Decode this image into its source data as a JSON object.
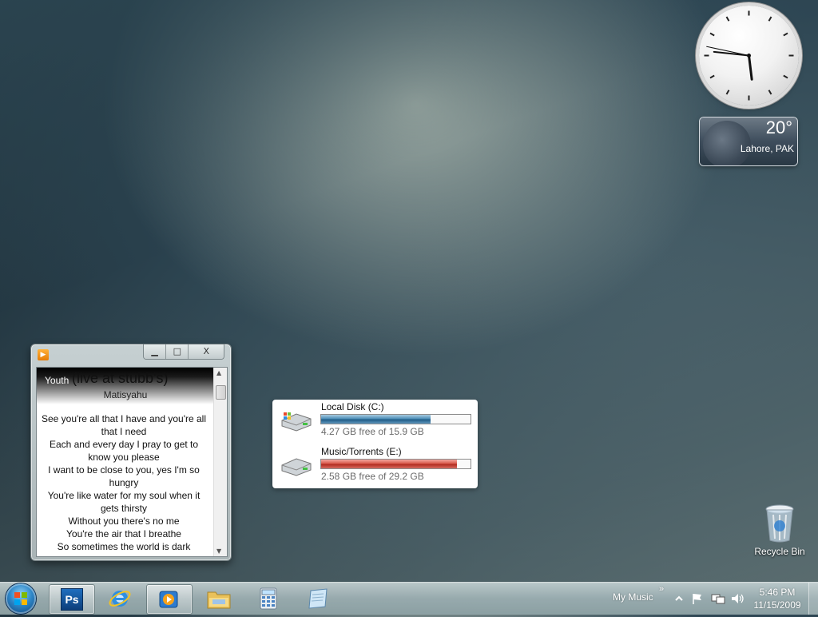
{
  "colors": {
    "accent": "#2d86c7",
    "drive_c_bar": "#1f5b85",
    "drive_e_bar": "#b02b20"
  },
  "weather": {
    "temperature": "20°",
    "location": "Lahore, PAK"
  },
  "clock_gadget": {
    "time": "5:46"
  },
  "player": {
    "title_icon": "media-player-icon",
    "minimize_label": "▁",
    "maximize_label": "□",
    "close_label": "X",
    "song": "Youth",
    "song_extra": "(live at stubb's)",
    "artist": "Matisyahu",
    "lyrics": [
      "See you're all that I have and you're all that I need",
      "Each and every day I pray to get to know you please",
      "I want to be close to you, yes I'm so hungry",
      "You're like water for my soul when it gets thirsty",
      "Without you there's no me",
      "You're the air that I breathe",
      "So sometimes the world is dark"
    ]
  },
  "drives": [
    {
      "name": "Local Disk (C:)",
      "free_text": "4.27 GB free of 15.9 GB",
      "used_fraction": 0.73,
      "color": "blue"
    },
    {
      "name": "Music/Torrents (E:)",
      "free_text": "2.58 GB free of 29.2 GB",
      "used_fraction": 0.91,
      "color": "red"
    }
  ],
  "desktop": {
    "recycle_bin_label": "Recycle Bin"
  },
  "taskbar": {
    "start_icon": "windows-logo-icon",
    "pinned": [
      {
        "name": "photoshop",
        "icon": "photoshop-icon",
        "label": "Ps",
        "active": true
      },
      {
        "name": "internet-explorer",
        "icon": "internet-explorer-icon",
        "active": false
      },
      {
        "name": "media-player",
        "icon": "media-player-icon",
        "active": true
      },
      {
        "name": "windows-explorer",
        "icon": "folder-icon",
        "active": false
      },
      {
        "name": "calculator",
        "icon": "calculator-icon",
        "active": false
      },
      {
        "name": "notepad",
        "icon": "notepad-icon",
        "active": false
      }
    ],
    "toolbar_label": "My Music",
    "toolbar_chevron": "»",
    "tray_time": "5:46 PM",
    "tray_date": "11/15/2009"
  }
}
